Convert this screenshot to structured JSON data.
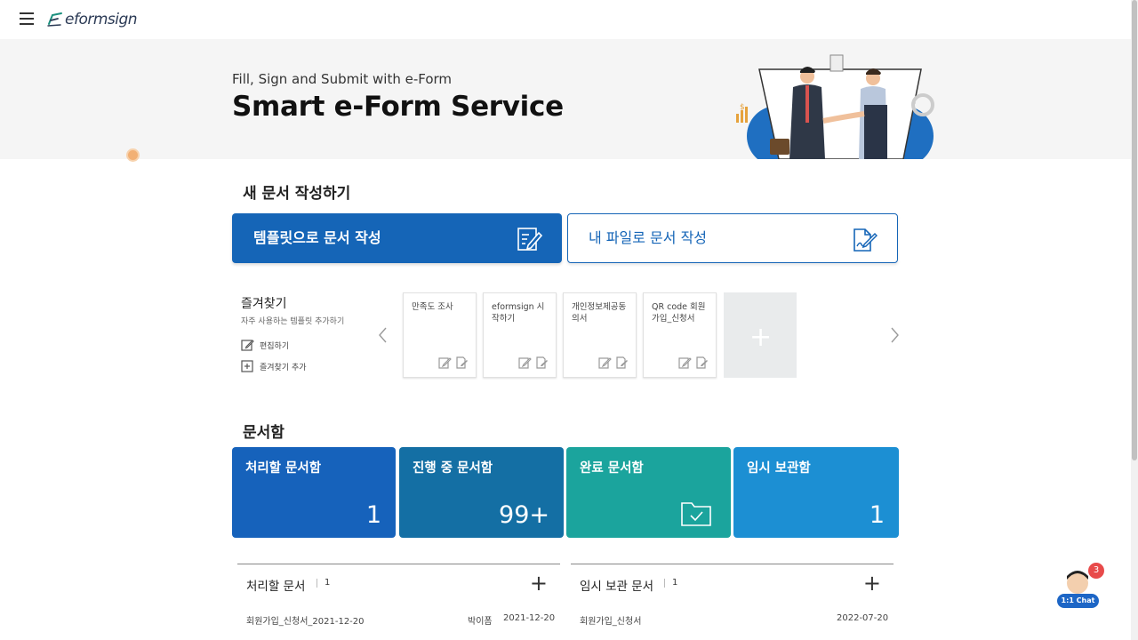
{
  "header": {
    "logo_text": "eformsign"
  },
  "hero": {
    "subtitle": "Fill, Sign and Submit with e-Form",
    "title": "Smart e-Form Service"
  },
  "new_document": {
    "section_title": "새 문서 작성하기",
    "template_button": "템플릿으로 문서 작성",
    "my_file_button": "내 파일로 문서 작성"
  },
  "favorites": {
    "title": "즐겨찾기",
    "description": "자주 사용하는 템플릿 추가하기",
    "edit_label": "편집하기",
    "add_label": "즐겨찾기 추가",
    "cards": [
      {
        "name": "만족도 조사"
      },
      {
        "name": "eformsign 시작하기"
      },
      {
        "name": "개인정보제공동의서"
      },
      {
        "name": "QR code 회원가입_신청서"
      }
    ]
  },
  "docbox": {
    "section_title": "문서함",
    "tiles": [
      {
        "label": "처리할 문서함",
        "count": "1"
      },
      {
        "label": "진행 중 문서함",
        "count": "99+"
      },
      {
        "label": "완료 문서함",
        "count": ""
      },
      {
        "label": "임시 보관함",
        "count": "1"
      }
    ]
  },
  "lists": {
    "todo": {
      "title": "처리할 문서",
      "count": "1",
      "rows": [
        {
          "name": "회원가입_신청서_2021-12-20",
          "author": "박이폼",
          "date": "2021-12-20"
        }
      ]
    },
    "draft": {
      "title": "임시 보관 문서",
      "count": "1",
      "rows": [
        {
          "name": "회원가입_신청서",
          "date": "2022-07-20"
        }
      ]
    }
  },
  "chat": {
    "label": "1:1 Chat",
    "badge": "3"
  },
  "colors": {
    "primary": "#1565b7",
    "tile_todo": "#1662bb",
    "tile_progress": "#146fa4",
    "tile_done": "#1ba49d",
    "tile_temp": "#1c8fd3"
  }
}
